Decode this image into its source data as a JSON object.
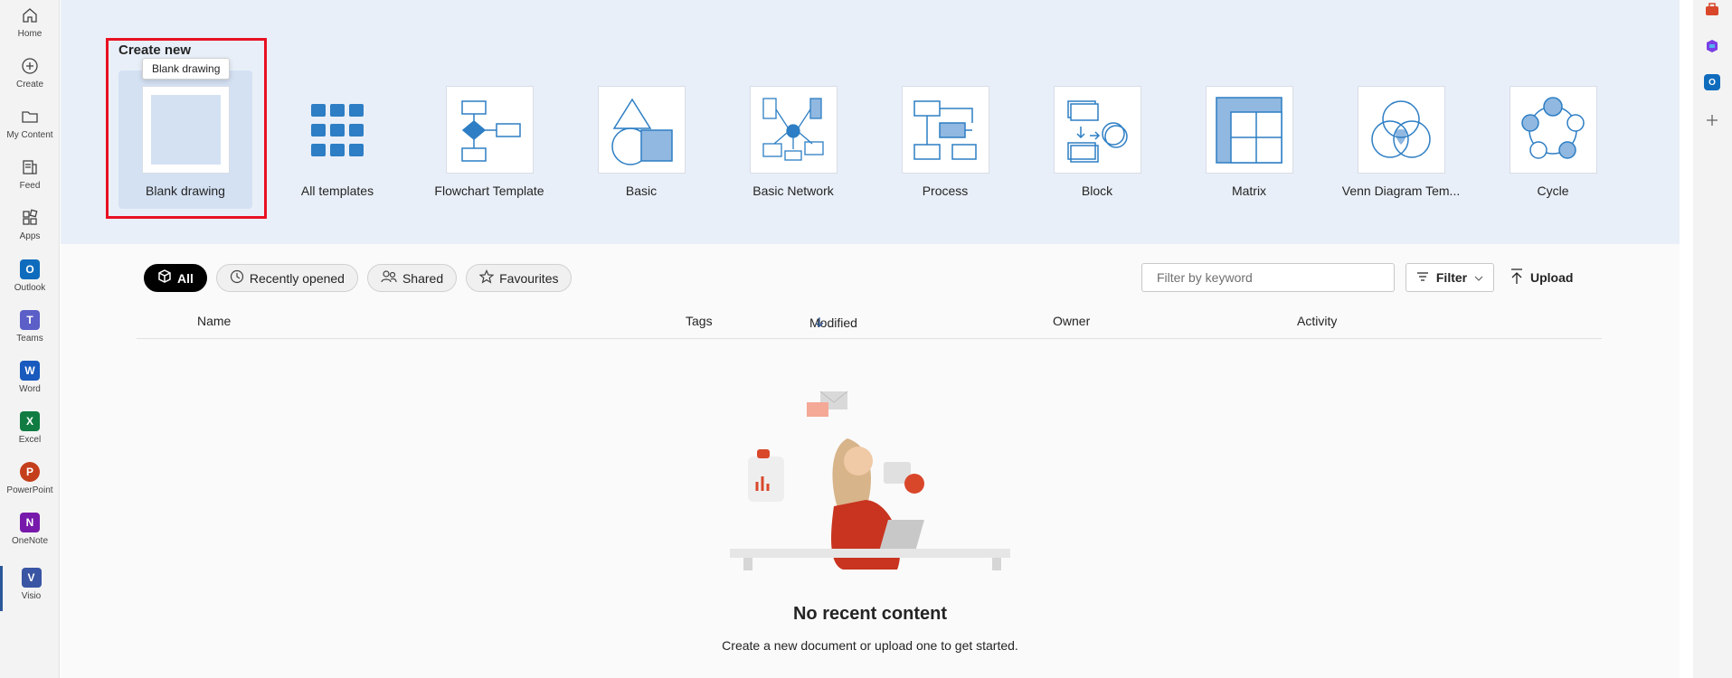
{
  "rail": {
    "items": [
      {
        "label": "Home",
        "icon": "home-icon"
      },
      {
        "label": "Create",
        "icon": "plus-circle-icon"
      },
      {
        "label": "My Content",
        "icon": "folder-icon"
      },
      {
        "label": "Feed",
        "icon": "feed-icon"
      },
      {
        "label": "Apps",
        "icon": "apps-icon"
      },
      {
        "label": "Outlook",
        "icon": "outlook-icon",
        "letter": "O",
        "color": "#0f6cbd"
      },
      {
        "label": "Teams",
        "icon": "teams-icon",
        "letter": "T",
        "color": "#5b5fc7"
      },
      {
        "label": "Word",
        "icon": "word-icon",
        "letter": "W",
        "color": "#185abd"
      },
      {
        "label": "Excel",
        "icon": "excel-icon",
        "letter": "X",
        "color": "#107c41"
      },
      {
        "label": "PowerPoint",
        "icon": "powerpoint-icon",
        "letter": "P",
        "color": "#c43e1c"
      },
      {
        "label": "OneNote",
        "icon": "onenote-icon",
        "letter": "N",
        "color": "#7719aa"
      },
      {
        "label": "Visio",
        "icon": "visio-icon",
        "letter": "V",
        "color": "#3955a3"
      }
    ]
  },
  "create": {
    "title": "Create new",
    "tooltip": "Blank drawing",
    "templates": [
      {
        "label": "Blank drawing"
      },
      {
        "label": "All templates"
      },
      {
        "label": "Flowchart Template"
      },
      {
        "label": "Basic"
      },
      {
        "label": "Basic Network"
      },
      {
        "label": "Process"
      },
      {
        "label": "Block"
      },
      {
        "label": "Matrix"
      },
      {
        "label": "Venn Diagram Tem..."
      },
      {
        "label": "Cycle"
      }
    ]
  },
  "filters": {
    "pills": [
      "All",
      "Recently opened",
      "Shared",
      "Favourites"
    ],
    "search_placeholder": "Filter by keyword",
    "filter_label": "Filter",
    "upload_label": "Upload"
  },
  "table": {
    "columns": [
      "Name",
      "Tags",
      "Modified",
      "Owner",
      "Activity"
    ]
  },
  "empty": {
    "title": "No recent content",
    "subtitle": "Create a new document or upload one to get started."
  },
  "colors": {
    "accent": "#2b579a",
    "template_blue": "#2d7ec4",
    "highlight": "#e81123"
  }
}
